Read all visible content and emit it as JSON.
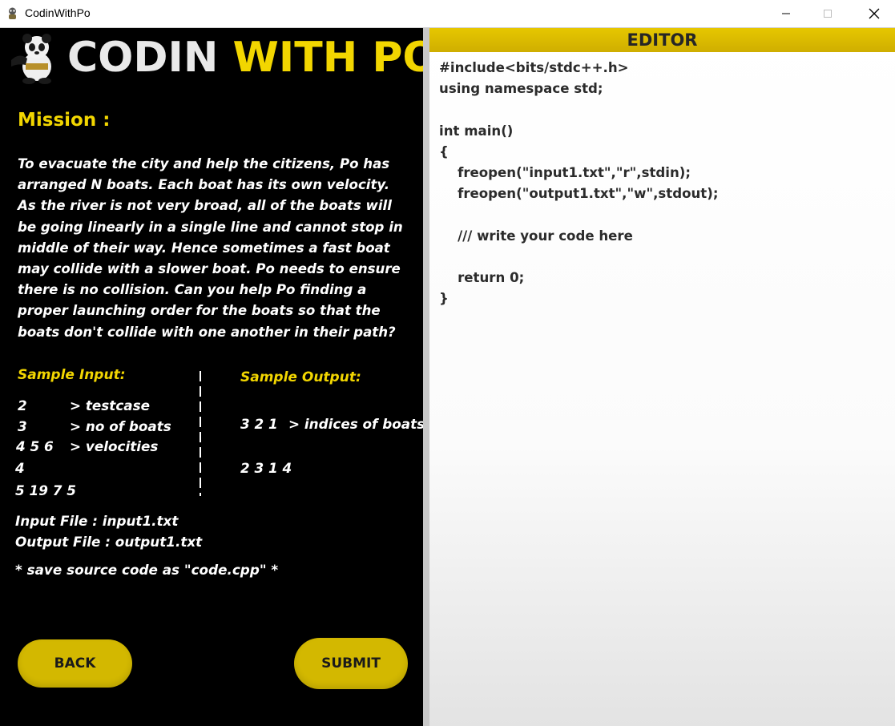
{
  "window": {
    "title": "CodinWithPo",
    "icon": "panda-icon",
    "controls": [
      "minimize-icon",
      "maximize-icon",
      "close-icon"
    ]
  },
  "brand": {
    "word1": "CODIN",
    "word2": "WITH PO"
  },
  "mission": {
    "heading": "Mission :",
    "text": "To evacuate the city and help the citizens, Po has arranged N boats. Each boat has its own velocity. As the river is not very broad, all of the boats will be going linearly in a single line and cannot stop in middle of their way. Hence sometimes a fast boat may collide with a slower boat. Po needs to ensure there is no collision. Can you help Po finding a proper launching order for the boats so that the boats don't collide with one another in their path?"
  },
  "sample_input": {
    "heading": "Sample Input:",
    "lines": [
      {
        "value": "2",
        "note": "> testcase"
      },
      {
        "value": "3",
        "note": "> no of boats"
      },
      {
        "value": "4 5 6",
        "note": "> velocities"
      },
      {
        "value": "4",
        "note": ""
      },
      {
        "value": "5 19 7 5",
        "note": ""
      }
    ]
  },
  "sample_output": {
    "heading": "Sample Output:",
    "lines": [
      {
        "value": "3 2 1",
        "note": "> indices of boats"
      },
      {
        "value": "2 3 1 4",
        "note": ""
      }
    ]
  },
  "files": {
    "input": "Input File : input1.txt",
    "output": "Output File : output1.txt",
    "save_note": "* save source code as \"code.cpp\" *"
  },
  "buttons": {
    "back": "BACK",
    "submit": "SUBMIT"
  },
  "editor": {
    "title": "EDITOR",
    "code": "#include<bits/stdc++.h>\nusing namespace std;\n\nint main()\n{\n    freopen(\"input1.txt\",\"r\",stdin);\n    freopen(\"output1.txt\",\"w\",stdout);\n\n    /// write your code here\n\n    return 0;\n}"
  },
  "colors": {
    "accent": "#f2d600",
    "button": "#d3b800",
    "background": "#000000"
  }
}
